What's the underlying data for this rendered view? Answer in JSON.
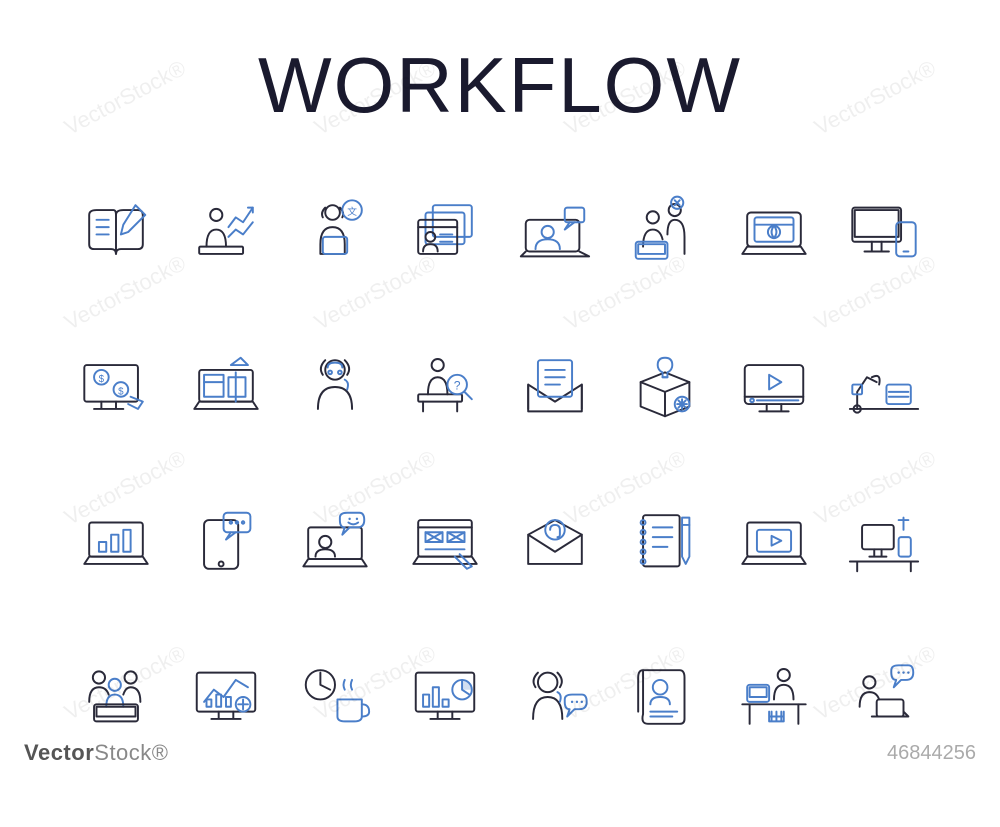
{
  "title": "WORKFLOW",
  "watermark_text": "VectorStock®",
  "footer": {
    "brand_bold": "Vector",
    "brand_light": "Stock®",
    "image_id": "46844256"
  },
  "colors": {
    "dark": "#2a2a3a",
    "blue": "#4a7ec9"
  },
  "icons": [
    [
      "book-write-icon",
      "analyst-chart-icon",
      "support-translate-icon",
      "profile-windows-icon",
      "video-call-icon",
      "pair-programming-icon",
      "laptop-web-icon",
      "desktop-mobile-icon"
    ],
    [
      "online-payment-icon",
      "laptop-design-icon",
      "support-agent-icon",
      "researcher-search-icon",
      "mail-document-icon",
      "idea-box-icon",
      "video-player-icon",
      "workstation-lamp-icon"
    ],
    [
      "laptop-chart-icon",
      "tablet-chat-icon",
      "laptop-chat-happy-icon",
      "wireframe-design-icon",
      "mail-attachment-icon",
      "notebook-pen-icon",
      "laptop-video-icon",
      "desk-computer-icon"
    ],
    [
      "team-meeting-icon",
      "monitor-analytics-icon",
      "coffee-break-icon",
      "monitor-stats-icon",
      "support-chat-icon",
      "resume-document-icon",
      "person-desk-work-icon",
      "remote-work-chat-icon"
    ]
  ]
}
